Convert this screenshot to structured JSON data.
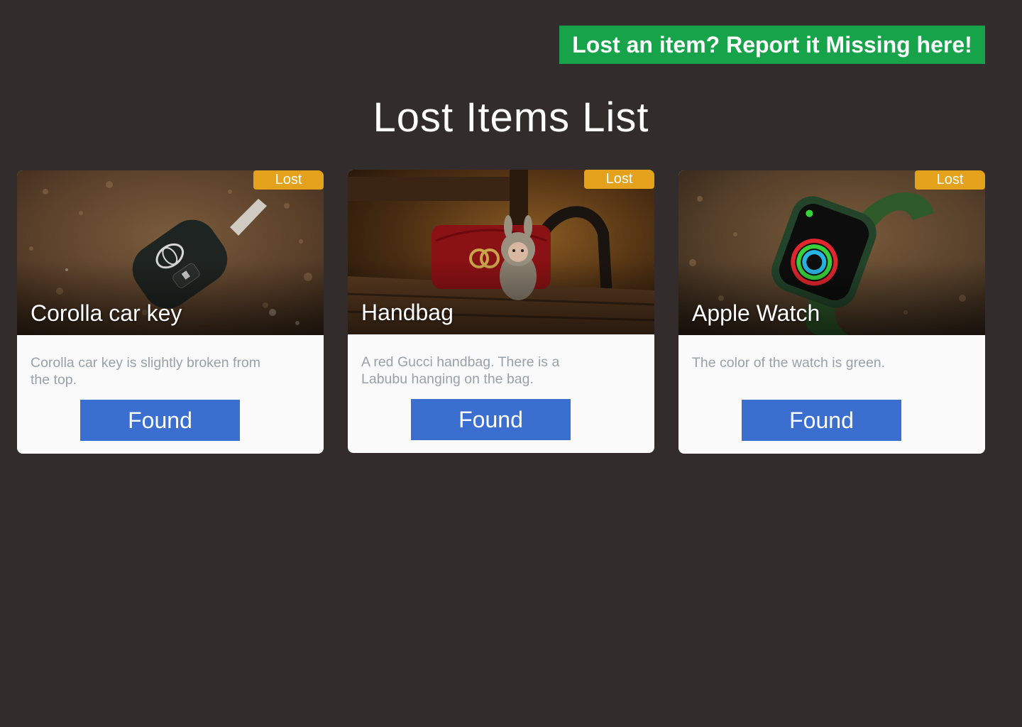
{
  "header": {
    "report_label": "Lost an item? Report it Missing here!",
    "title": "Lost Items List"
  },
  "colors": {
    "background": "#322c2d",
    "report_button": "#16a34a",
    "status_badge": "#e4a11b",
    "found_button": "#3b6fcf",
    "card": "#fafafa",
    "description_text": "#9aa0a8"
  },
  "items": [
    {
      "title": "Corolla car key",
      "status": "Lost",
      "description": "Corolla car key is slightly broken from the top.",
      "action_label": "Found",
      "image": "car-key-photo"
    },
    {
      "title": "Handbag",
      "status": "Lost",
      "description": "A red Gucci handbag. There is a Labubu hanging on the bag.",
      "action_label": "Found",
      "image": "handbag-photo"
    },
    {
      "title": "Apple Watch",
      "status": "Lost",
      "description": "The color of the watch is green.",
      "action_label": "Found",
      "image": "watch-photo"
    }
  ]
}
